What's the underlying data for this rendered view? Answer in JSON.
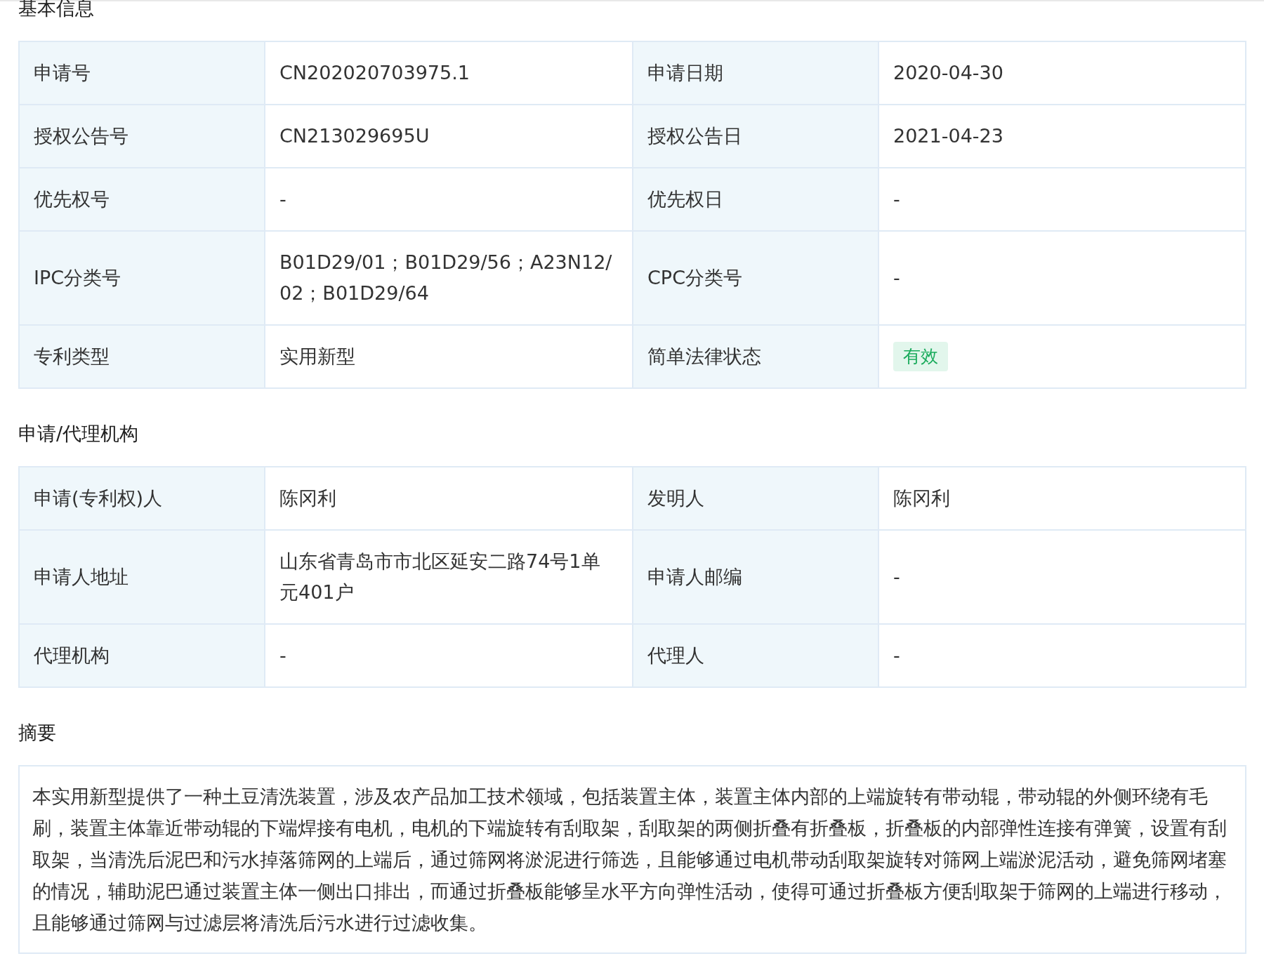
{
  "sections": [
    {
      "title": "基本信息",
      "kind": "table",
      "rows": [
        [
          {
            "label": "申请号",
            "value": "CN202020703975.1",
            "kind": "text"
          },
          {
            "label": "申请日期",
            "value": "2020-04-30",
            "kind": "text"
          }
        ],
        [
          {
            "label": "授权公告号",
            "value": "CN213029695U",
            "kind": "text"
          },
          {
            "label": "授权公告日",
            "value": "2021-04-23",
            "kind": "text"
          }
        ],
        [
          {
            "label": "优先权号",
            "value": "-",
            "kind": "text"
          },
          {
            "label": "优先权日",
            "value": "-",
            "kind": "text"
          }
        ],
        [
          {
            "label": "IPC分类号",
            "value": "B01D29/01；B01D29/56；A23N12/02；B01D29/64",
            "kind": "text"
          },
          {
            "label": "CPC分类号",
            "value": "-",
            "kind": "text"
          }
        ],
        [
          {
            "label": "专利类型",
            "value": "实用新型",
            "kind": "text"
          },
          {
            "label": "简单法律状态",
            "value": "有效",
            "kind": "tag"
          }
        ]
      ]
    },
    {
      "title": "申请/代理机构",
      "kind": "table",
      "rows": [
        [
          {
            "label": "申请(专利权)人",
            "value": "陈冈利",
            "kind": "text"
          },
          {
            "label": "发明人",
            "value": "陈冈利",
            "kind": "text"
          }
        ],
        [
          {
            "label": "申请人地址",
            "value": "山东省青岛市市北区延安二路74号1单元401户",
            "kind": "text"
          },
          {
            "label": "申请人邮编",
            "value": "-",
            "kind": "text"
          }
        ],
        [
          {
            "label": "代理机构",
            "value": "-",
            "kind": "text"
          },
          {
            "label": "代理人",
            "value": "-",
            "kind": "text"
          }
        ]
      ]
    },
    {
      "title": "摘要",
      "kind": "text",
      "text": "本实用新型提供了一种土豆清洗装置，涉及农产品加工技术领域，包括装置主体，装置主体内部的上端旋转有带动辊，带动辊的外侧环绕有毛刷，装置主体靠近带动辊的下端焊接有电机，电机的下端旋转有刮取架，刮取架的两侧折叠有折叠板，折叠板的内部弹性连接有弹簧，设置有刮取架，当清洗后泥巴和污水掉落筛网的上端后，通过筛网将淤泥进行筛选，且能够通过电机带动刮取架旋转对筛网上端淤泥活动，避免筛网堵塞的情况，辅助泥巴通过装置主体一侧出口排出，而通过折叠板能够呈水平方向弹性活动，使得可通过折叠板方便刮取架于筛网的上端进行移动，且能够通过筛网与过滤层将清洗后污水进行过滤收集。"
    }
  ]
}
